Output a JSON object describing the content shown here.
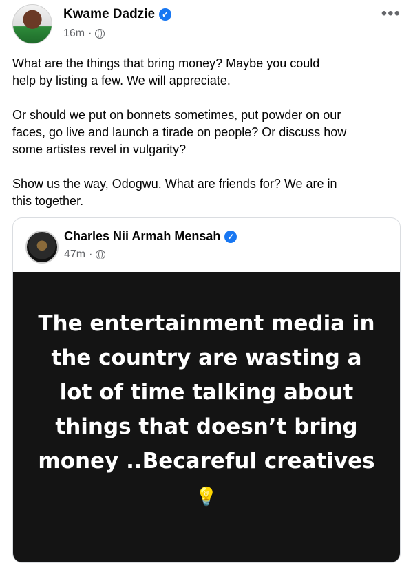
{
  "post": {
    "author": "Kwame Dadzie",
    "time": "16m",
    "separator": "·",
    "more_label": "•••",
    "paragraphs": [
      "What are the things that bring money? Maybe you could\nhelp by listing a few. We will appreciate.",
      "Or should we put on bonnets sometimes, put powder on our\nfaces, go live and launch a tirade on people? Or discuss how\nsome artistes revel in vulgarity?",
      "Show us the way, Odogwu. What are friends for? We are in\nthis together."
    ]
  },
  "shared": {
    "author": "Charles Nii Armah Mensah",
    "time": "47m",
    "separator": "·",
    "story_text": "The entertainment media in the country are wasting a lot of time talking about things that doesn’t bring money ..Becareful creatives",
    "story_emoji": "💡"
  },
  "icons": {
    "verified": "verified-badge-icon",
    "privacy": "globe-icon",
    "more": "more-options-icon",
    "bulb": "light-bulb-icon"
  },
  "colors": {
    "verified": "#1877f2",
    "meta_text": "#65676b",
    "story_background": "#141414"
  }
}
